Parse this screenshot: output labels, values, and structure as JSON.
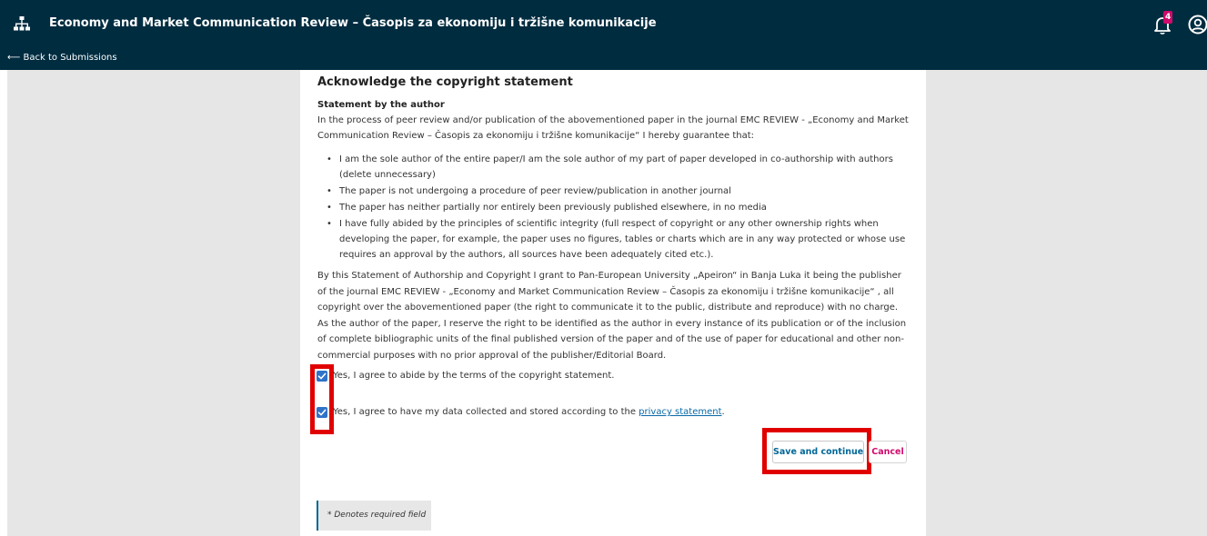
{
  "header": {
    "title": "Economy and Market Communication Review – Časopis za ekonomiju i tržišne komunikacije",
    "notification_count": "4",
    "back_link": "⟵ Back to Submissions"
  },
  "form": {
    "heading": "Acknowledge the copyright statement",
    "statement_title": "Statement by the author",
    "intro": "In the process of peer review and/or publication of the abovementioned paper in the journal EMC REVIEW - „Economy and Market Communication Review – Časopis za ekonomiju i tržišne komunikacije“ I hereby guarantee that:",
    "bullets": [
      "I am the sole author of the entire paper/I am the sole author of my part of paper developed in co-authorship with authors (delete unnecessary)",
      "The paper is not undergoing a procedure of peer review/publication in another journal",
      "The paper has neither partially nor entirely been previously published elsewhere, in no media",
      "I have fully abided by the principles of scientific integrity (full respect of copyright or any other ownership rights when developing the paper, for example, the paper uses no figures, tables or charts which are in any way protected or whose use requires an approval by the authors, all sources have been adequately cited etc.)."
    ],
    "body": "By this Statement of Authorship and Copyright I grant to Pan-European University „Apeiron“ in Banja Luka it being the publisher of the journal EMC REVIEW - „Economy and Market Communication Review – Časopis za ekonomiju i tržišne komunikacije“ , all copyright over the abovementioned paper (the right to communicate it to the public, distribute and reproduce) with no charge. As the author of the paper, I reserve the right to be identified as the author in every instance of its publication or of the inclusion of complete bibliographic units of the final published version of the paper and of the use of paper for educational and other non-commercial purposes with no prior approval of the publisher/Editorial Board.",
    "checkbox_copyright": "Yes, I agree to abide by the terms of the copyright statement.",
    "checkbox_privacy_prefix": "Yes, I agree to have my data collected and stored according to the ",
    "privacy_link": "privacy statement",
    "checkbox_privacy_suffix": ".",
    "save_label": "Save and continue",
    "cancel_label": "Cancel",
    "required_note": "* Denotes required field"
  },
  "colors": {
    "header_bg": "#002c40",
    "highlight": "#e10000",
    "primary": "#006798",
    "cancel": "#d00a6c",
    "checkbox": "#2f73c9"
  }
}
